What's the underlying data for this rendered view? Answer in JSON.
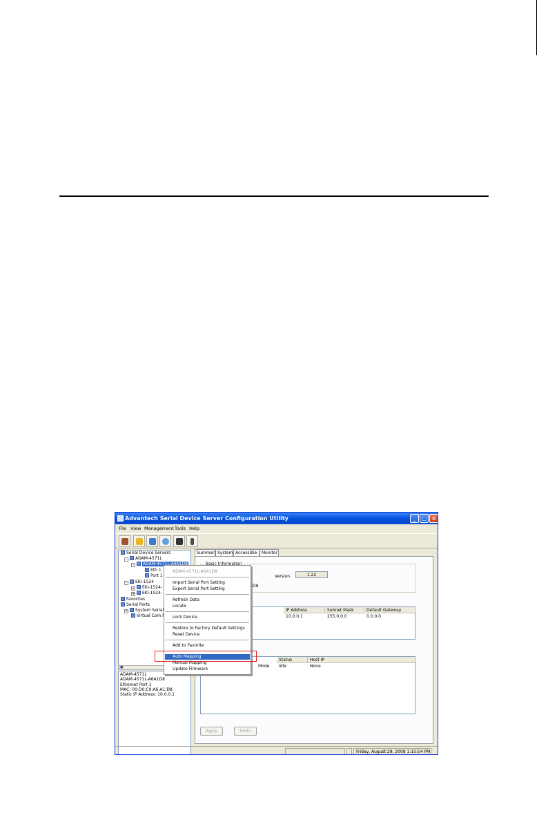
{
  "window": {
    "title": "Advantech Serial Device Server Configuration Utility",
    "menu": [
      "File",
      "View",
      "Management",
      "Tools",
      "Help"
    ],
    "toolbar_icons": [
      "add-device-icon",
      "search-device-icon",
      "refresh-icon",
      "locate-icon",
      "find-icon",
      "device-icon"
    ]
  },
  "tree": [
    {
      "label": "Serial Device Servers",
      "icon": "server-group-icon"
    },
    {
      "label": "ADAM-4571L",
      "icon": "device-icon"
    },
    {
      "label": "ADAM-4571L-A6A1D8",
      "icon": "device-icon"
    },
    {
      "label": "Eth 1",
      "icon": "ethernet-icon"
    },
    {
      "label": "Port 1",
      "icon": "port-icon"
    },
    {
      "label": "EKI-1524",
      "icon": "device-icon"
    },
    {
      "label": "EKI-1524-",
      "icon": "device-icon"
    },
    {
      "label": "EKI-1524-",
      "icon": "device-icon"
    },
    {
      "label": "Favorites",
      "icon": "favorites-icon"
    },
    {
      "label": "Serial Ports",
      "icon": "serial-ports-icon"
    },
    {
      "label": "System Serial",
      "icon": "port-icon"
    },
    {
      "label": "Virtual Com Po",
      "icon": "port-icon"
    }
  ],
  "info_panel": [
    "ADAM-4571L",
    "ADAM-4571L-A6A1D8",
    "Ethernet Port 1",
    "MAC: 00:D0:C9:A6:A1:D8",
    "Static IP Address: 10.0.0.1"
  ],
  "tabs": [
    "Summary",
    "System",
    "Accessible",
    "Monitor"
  ],
  "basic_info": {
    "legend": "Basic Information",
    "version_label": "Version",
    "version_value": "1.22",
    "partial_value": "D8"
  },
  "network_table": {
    "headers": [
      "IP Address",
      "Subnet Mask",
      "Default Gateway"
    ],
    "row": [
      "10.0.0.1",
      "255.0.0.0",
      "0.0.0.0"
    ]
  },
  "port_table": {
    "headers": [
      "Status",
      "Host IP"
    ],
    "row": [
      "Mode",
      "Idle",
      "None"
    ]
  },
  "buttons": {
    "apply": "Apply",
    "undo": "Undo"
  },
  "status_bar": {
    "datetime": "Friday, August 29, 2008  1:15:54 PM"
  },
  "context_menu": {
    "header": "ADAM-4571L-A6A1D8",
    "groups": [
      [
        "Import Serial Port Setting",
        "Export Serial Port Setting"
      ],
      [
        "Refresh Data",
        "Locate"
      ],
      [
        "Lock Device"
      ],
      [
        "Restore to Factory Default Settings",
        "Reset Device"
      ],
      [
        "Add to Favorite"
      ],
      [
        "Auto Mapping",
        "Manual Mapping",
        "Update Firmware"
      ]
    ],
    "active_item": "Auto Mapping"
  }
}
